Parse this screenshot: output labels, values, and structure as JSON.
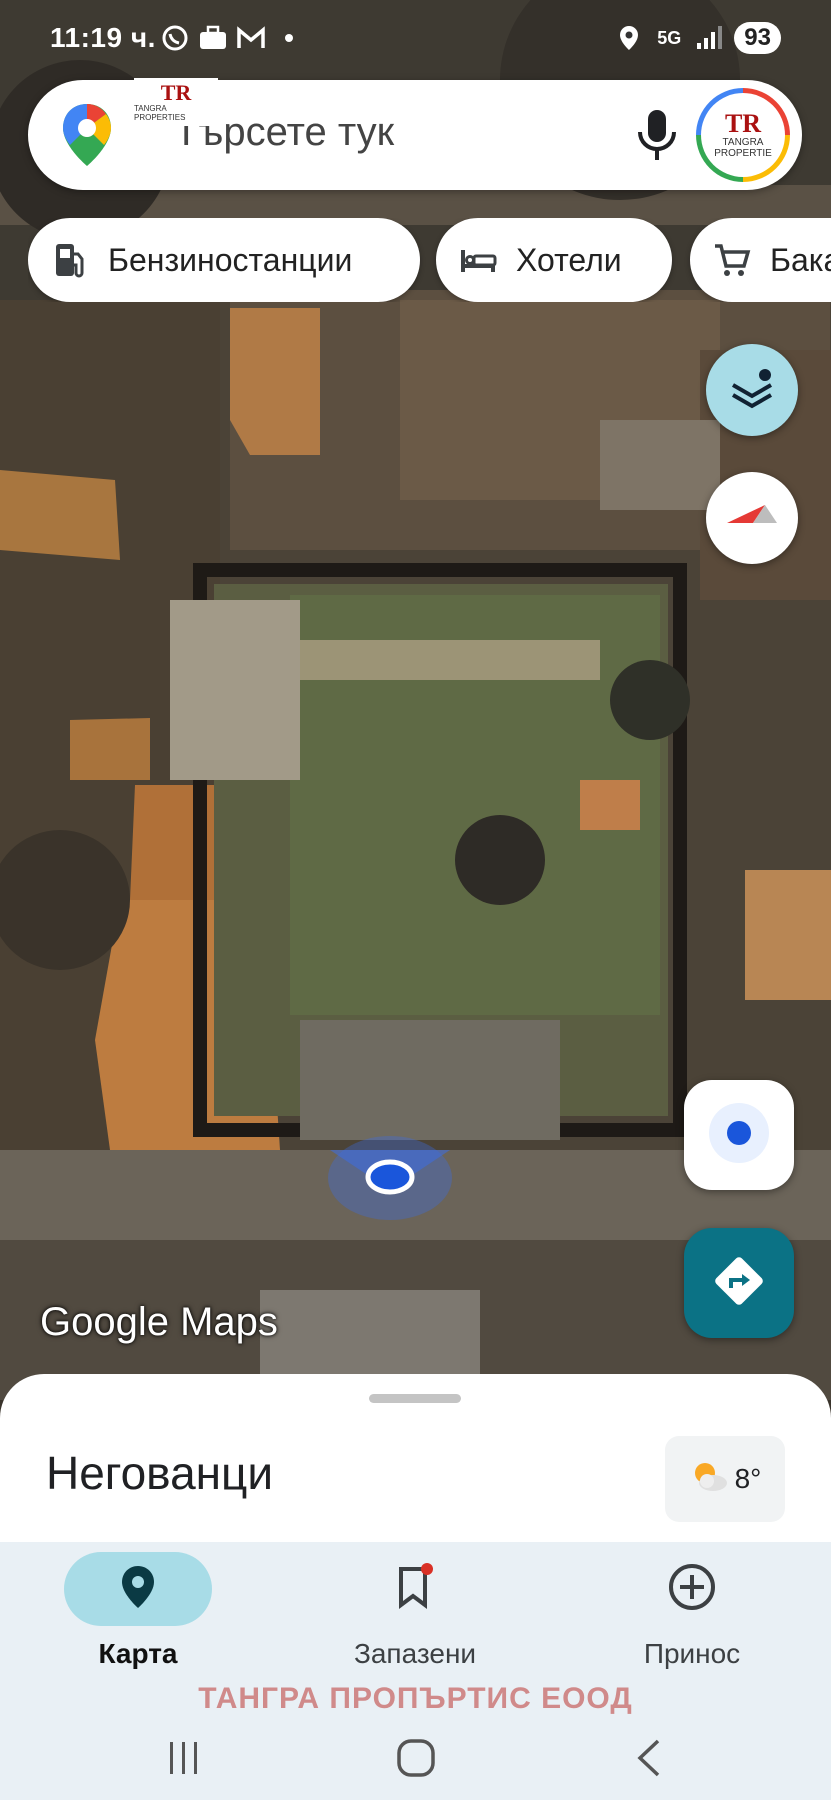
{
  "status_bar": {
    "time": "11:19 ч.",
    "battery": "93",
    "network": "5G"
  },
  "watermark": {
    "logo_text": "TR",
    "company": "TANGRA PROPERTIES",
    "company_short": "TANGRA",
    "company_short2": "PROPERTIE",
    "footer_text": "ТАНГРА ПРОПЪРТИС  ЕООД"
  },
  "search": {
    "placeholder": "Търсете тук"
  },
  "chips": [
    {
      "label": "Бензиностанции",
      "icon": "gas-station-icon"
    },
    {
      "label": "Хотели",
      "icon": "bed-icon"
    },
    {
      "label": "Бака",
      "icon": "cart-icon"
    }
  ],
  "map": {
    "attribution": "Google Maps"
  },
  "sheet": {
    "place_name": "Негованци",
    "weather_temp": "8°",
    "weather_icon": "partly-cloudy-icon"
  },
  "bottom_nav": [
    {
      "label": "Карта",
      "icon": "map-pin-icon",
      "active": true
    },
    {
      "label": "Запазени",
      "icon": "bookmark-icon",
      "active": false
    },
    {
      "label": "Принос",
      "icon": "add-circle-icon",
      "active": false
    }
  ],
  "colors": {
    "accent_teal": "#0b7285",
    "active_pill": "#a8dce7",
    "location_blue": "#1a56db",
    "layers_button": "#a8dce7"
  }
}
